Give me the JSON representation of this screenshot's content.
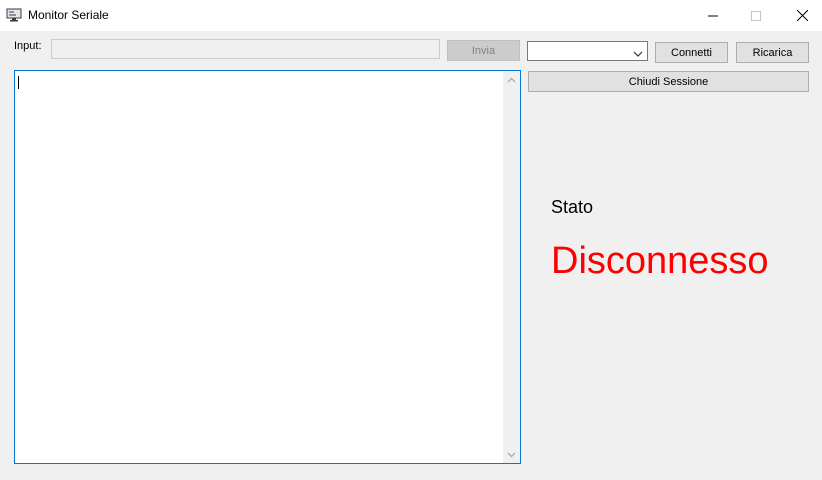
{
  "window": {
    "title": "Monitor Seriale",
    "icon": "monitor-icon"
  },
  "controls": {
    "input_label": "Input:",
    "input_value": "",
    "send_label": "Invia",
    "port_selected": "",
    "connect_label": "Connetti",
    "reload_label": "Ricarica",
    "close_session_label": "Chiudi Sessione"
  },
  "output": {
    "text": ""
  },
  "status": {
    "label": "Stato",
    "value": "Disconnesso",
    "color": "#ff0000"
  }
}
